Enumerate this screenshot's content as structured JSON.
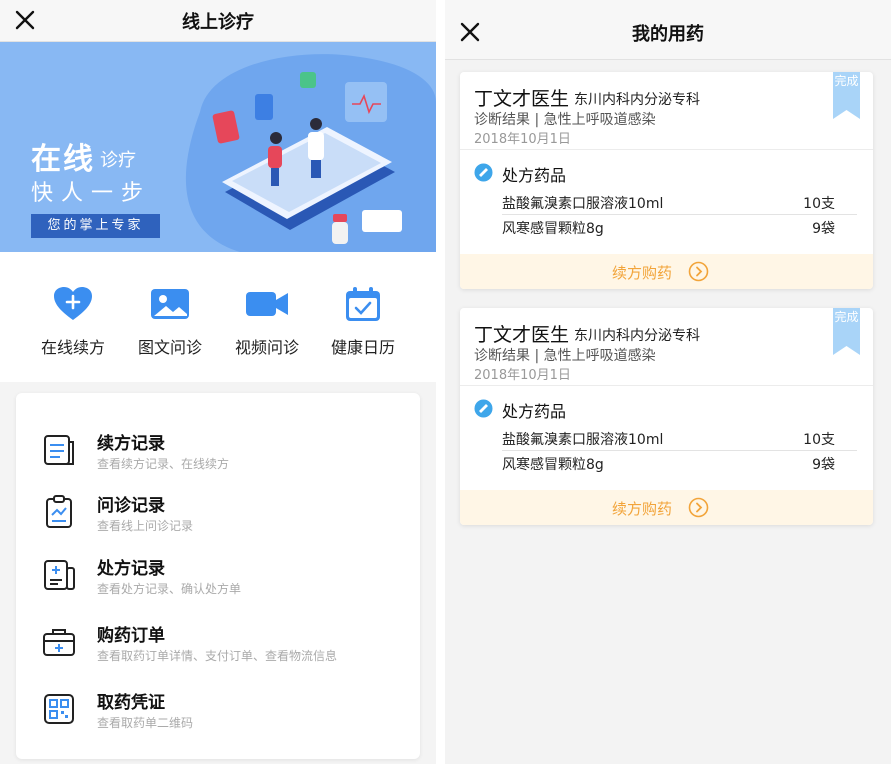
{
  "left": {
    "header": {
      "title": "线上诊疗",
      "close_icon": "close-icon"
    },
    "banner": {
      "line1": "在线",
      "line1_small": "诊疗",
      "line2": "快人一步",
      "tag": "您的掌上专家",
      "bg_color": "#88b8f3"
    },
    "quick_actions": [
      {
        "label": "在线续方",
        "icon": "heart-plus-icon"
      },
      {
        "label": "图文问诊",
        "icon": "image-icon"
      },
      {
        "label": "视频问诊",
        "icon": "video-camera-icon"
      },
      {
        "label": "健康日历",
        "icon": "calendar-check-icon"
      }
    ],
    "menu": [
      {
        "title": "续方记录",
        "subtitle": "查看续方记录、在线续方",
        "icon": "document-icon"
      },
      {
        "title": "问诊记录",
        "subtitle": "查看线上问诊记录",
        "icon": "clipboard-chart-icon"
      },
      {
        "title": "处方记录",
        "subtitle": "查看处方记录、确认处方单",
        "icon": "prescription-icon"
      },
      {
        "title": "购药订单",
        "subtitle": "查看取药订单详情、支付订单、查看物流信息",
        "icon": "medical-kit-icon"
      },
      {
        "title": "取药凭证",
        "subtitle": "查看取药单二维码",
        "icon": "qr-code-icon"
      }
    ],
    "accent_color": "#3b8ef0"
  },
  "right": {
    "header": {
      "title": "我的用药",
      "close_icon": "close-icon"
    },
    "cards": [
      {
        "doctor": "丁文才医生",
        "department": "东川内科内分泌专科",
        "diagnosis": "诊断结果 | 急性上呼吸道感染",
        "date": "2018年10月1日",
        "status": "完成",
        "section_title": "处方药品",
        "drugs": [
          {
            "name": "盐酸氟溴素口服溶液10ml",
            "qty": "10支"
          },
          {
            "name": "风寒感冒颗粒8g",
            "qty": "9袋"
          }
        ],
        "action": "续方购药"
      },
      {
        "doctor": "丁文才医生",
        "department": "东川内科内分泌专科",
        "diagnosis": "诊断结果 | 急性上呼吸道感染",
        "date": "2018年10月1日",
        "status": "完成",
        "section_title": "处方药品",
        "drugs": [
          {
            "name": "盐酸氟溴素口服溶液10ml",
            "qty": "10支"
          },
          {
            "name": "风寒感冒颗粒8g",
            "qty": "9袋"
          }
        ],
        "action": "续方购药"
      }
    ],
    "action_color": "#f2a43a",
    "ribbon_color": "#a9d4f8"
  }
}
